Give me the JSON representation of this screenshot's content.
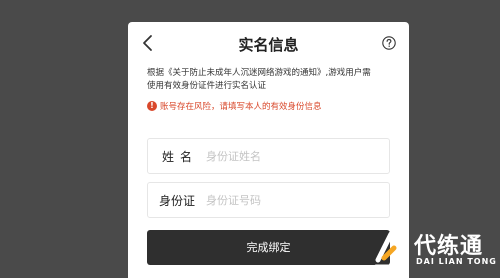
{
  "dialog": {
    "title": "实名信息",
    "notice_line1": "根据《关于防止未成年人沉迷网络游戏的通知》,游戏用户需",
    "notice_line2": "使用有效身份证件进行实名认证",
    "warning": "账号存在风险，请填写本人的有效身份信息",
    "name_field": {
      "label": "姓名",
      "placeholder": "身份证姓名",
      "value": ""
    },
    "id_field": {
      "label": "身份证",
      "placeholder": "身份证号码",
      "value": ""
    },
    "submit_label": "完成绑定"
  },
  "watermark": {
    "main": "代练通",
    "sub": "DAI LIAN TONG"
  },
  "colors": {
    "background": "#4a4a4a",
    "warning": "#d9482b",
    "button": "#2f2f2f",
    "watermark_accent": "#f5a623"
  }
}
